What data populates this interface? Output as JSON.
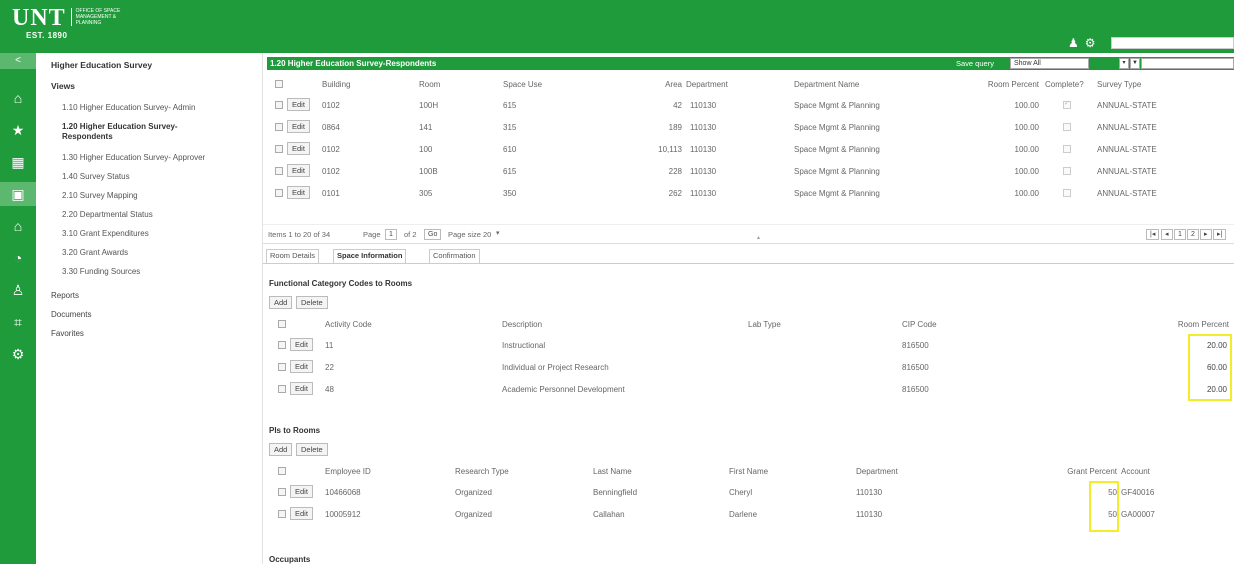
{
  "header": {
    "logo_text": "UNT",
    "logo_subtitle": "Office of Space Management & Planning",
    "est": "EST. 1890"
  },
  "rail": {
    "collapse": "<",
    "items": [
      {
        "icon": "home-icon",
        "glyph": "⌂"
      },
      {
        "icon": "star-icon",
        "glyph": "★"
      },
      {
        "icon": "floorplan-icon",
        "glyph": "▦"
      },
      {
        "icon": "building-icon",
        "glyph": "▣"
      },
      {
        "icon": "campus-icon",
        "glyph": "⌂"
      },
      {
        "icon": "pie-chart-icon",
        "glyph": "◔"
      },
      {
        "icon": "chair-icon",
        "glyph": "♙"
      },
      {
        "icon": "report-chart-icon",
        "glyph": "⌗"
      },
      {
        "icon": "settings-icon",
        "glyph": "⚙"
      }
    ]
  },
  "nav": {
    "title": "Higher Education Survey",
    "views_label": "Views",
    "items": [
      "1.10 Higher Education Survey- Admin",
      "1.20 Higher Education Survey- Respondents",
      "1.30 Higher Education Survey- Approver",
      "1.40 Survey Status",
      "2.10 Survey Mapping",
      "2.20 Departmental Status",
      "3.10 Grant Expenditures",
      "3.20 Grant Awards",
      "3.30 Funding Sources"
    ],
    "sections": [
      "Reports",
      "Documents",
      "Favorites"
    ]
  },
  "panel": {
    "title": "1.20 Higher Education Survey-Respondents",
    "save_query": "Save query",
    "show_all": "Show All"
  },
  "grid": {
    "headers": [
      "Building",
      "Room",
      "Space Use",
      "Area",
      "Department",
      "Department Name",
      "Room Percent",
      "Complete?",
      "Survey Type"
    ],
    "edit_label": "Edit",
    "rows": [
      {
        "building": "0102",
        "room": "100H",
        "space_use": "615",
        "area": "42",
        "department": "110130",
        "dept_name": "Space Mgmt & Planning",
        "room_percent": "100.00",
        "complete": true,
        "survey_type": "ANNUAL-STATE"
      },
      {
        "building": "0864",
        "room": "141",
        "space_use": "315",
        "area": "189",
        "department": "110130",
        "dept_name": "Space Mgmt & Planning",
        "room_percent": "100.00",
        "complete": false,
        "survey_type": "ANNUAL-STATE"
      },
      {
        "building": "0102",
        "room": "100",
        "space_use": "610",
        "area": "10,113",
        "department": "110130",
        "dept_name": "Space Mgmt & Planning",
        "room_percent": "100.00",
        "complete": false,
        "survey_type": "ANNUAL-STATE"
      },
      {
        "building": "0102",
        "room": "100B",
        "space_use": "615",
        "area": "228",
        "department": "110130",
        "dept_name": "Space Mgmt & Planning",
        "room_percent": "100.00",
        "complete": false,
        "survey_type": "ANNUAL-STATE"
      },
      {
        "building": "0101",
        "room": "305",
        "space_use": "350",
        "area": "262",
        "department": "110130",
        "dept_name": "Space Mgmt & Planning",
        "room_percent": "100.00",
        "complete": false,
        "survey_type": "ANNUAL-STATE"
      }
    ]
  },
  "pager": {
    "items": "Items 1 to 20 of 34",
    "page_label": "Page",
    "page": "1",
    "of": "of 2",
    "go": "Go",
    "page_size_label": "Page size",
    "page_size": "20",
    "nav": [
      "|◂",
      "◂",
      "1",
      "2",
      "▸",
      "▸|"
    ]
  },
  "tabs": [
    "Room Details",
    "Space Information",
    "Confirmation"
  ],
  "fcc": {
    "title": "Functional Category Codes to Rooms",
    "add": "Add",
    "delete": "Delete",
    "headers": [
      "Activity Code",
      "Description",
      "Lab Type",
      "CIP Code",
      "Room Percent"
    ],
    "rows": [
      {
        "code": "11",
        "description": "Instructional",
        "lab_type": "",
        "cip": "816500",
        "percent": "20.00"
      },
      {
        "code": "22",
        "description": "Individual or Project Research",
        "lab_type": "",
        "cip": "816500",
        "percent": "60.00"
      },
      {
        "code": "48",
        "description": "Academic Personnel Development",
        "lab_type": "",
        "cip": "816500",
        "percent": "20.00"
      }
    ]
  },
  "pis": {
    "title": "PIs to Rooms",
    "add": "Add",
    "delete": "Delete",
    "headers": [
      "Employee ID",
      "Research Type",
      "Last Name",
      "First Name",
      "Department",
      "Grant Percent",
      "Account"
    ],
    "rows": [
      {
        "employee_id": "10466068",
        "research_type": "Organized",
        "last_name": "Benningfield",
        "first_name": "Cheryl",
        "department": "110130",
        "grant_percent": "50",
        "account": "GF40016"
      },
      {
        "employee_id": "10005912",
        "research_type": "Organized",
        "last_name": "Callahan",
        "first_name": "Darlene",
        "department": "110130",
        "grant_percent": "50",
        "account": "GA00007"
      }
    ]
  },
  "occupants": {
    "title": "Occupants"
  },
  "colors": {
    "brand_green": "#1f9b3c",
    "rail_active": "#5cb86f",
    "highlight": "#f2ec2a"
  }
}
